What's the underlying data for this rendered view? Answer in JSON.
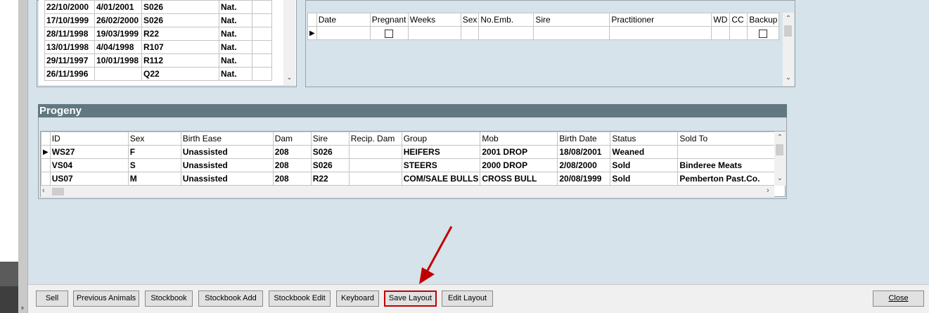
{
  "left_table": {
    "rows": [
      [
        "22/10/2000",
        "4/01/2001",
        "S026",
        "Nat.",
        ""
      ],
      [
        "17/10/1999",
        "26/02/2000",
        "S026",
        "Nat.",
        ""
      ],
      [
        "28/11/1998",
        "19/03/1999",
        "R22",
        "Nat.",
        ""
      ],
      [
        "13/01/1998",
        "4/04/1998",
        "R107",
        "Nat.",
        ""
      ],
      [
        "29/11/1997",
        "10/01/1998",
        "R112",
        "Nat.",
        ""
      ],
      [
        "26/11/1996",
        "",
        "Q22",
        "Nat.",
        ""
      ]
    ]
  },
  "pregnancy_table": {
    "headers": [
      "Date",
      "Pregnant",
      "Weeks",
      "Sex",
      "No.Emb.",
      "Sire",
      "Practitioner",
      "WD",
      "CC",
      "Backup"
    ]
  },
  "progeny": {
    "title": "Progeny",
    "headers": [
      "ID",
      "Sex",
      "Birth Ease",
      "Dam",
      "Sire",
      "Recip. Dam",
      "Group",
      "Mob",
      "Birth Date",
      "Status",
      "Sold To"
    ],
    "rows": [
      [
        "WS27",
        "F",
        "Unassisted",
        "208",
        "S026",
        "",
        "HEIFERS",
        "2001 DROP",
        "18/08/2001",
        "Weaned",
        ""
      ],
      [
        "VS04",
        "S",
        "Unassisted",
        "208",
        "S026",
        "",
        "STEERS",
        "2000 DROP",
        "2/08/2000",
        "Sold",
        "Binderee Meats"
      ],
      [
        "US07",
        "M",
        "Unassisted",
        "208",
        "R22",
        "",
        "COM/SALE BULLS",
        "CROSS BULL",
        "20/08/1999",
        "Sold",
        "Pemberton Past.Co."
      ]
    ]
  },
  "toolbar": {
    "sell": "Sell",
    "previous_animals": "Previous Animals",
    "stockbook": "Stockbook",
    "stockbook_add": "Stockbook Add",
    "stockbook_edit": "Stockbook Edit",
    "keyboard": "Keyboard",
    "save_layout": "Save Layout",
    "edit_layout": "Edit Layout",
    "close": "Close"
  },
  "colors": {
    "background": "#d6e3ea",
    "section_header": "#627880",
    "highlight_border": "#c00000",
    "annotation_arrow": "#c00000"
  }
}
